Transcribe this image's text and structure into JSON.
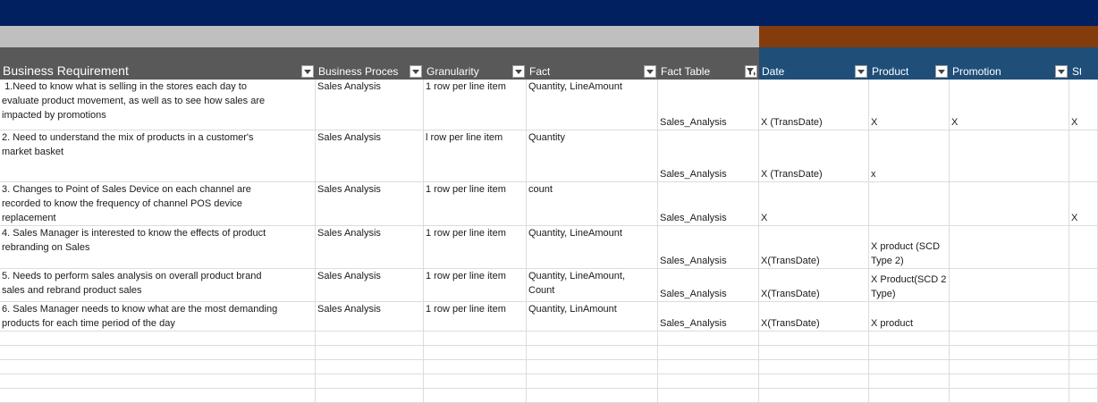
{
  "headers": {
    "business_requirement": "Business Requirement",
    "business_process": "Business Proces",
    "granularity": "Granularity",
    "fact": "Fact",
    "fact_table": "Fact Table",
    "date": "Date",
    "product": "Product",
    "promotion": "Promotion",
    "store": "Store"
  },
  "colors": {
    "title_band": "#002060",
    "grey_band": "#bfbfbf",
    "brown_band": "#843c0c",
    "header_dark": "#595959",
    "header_blue": "#1f4e79"
  },
  "filter_icons": {
    "business_requirement": "dropdown-arrow",
    "business_process": "dropdown-arrow",
    "granularity": "dropdown-arrow",
    "fact": "dropdown-arrow",
    "fact_table": "filter-funnel",
    "date": "dropdown-arrow",
    "product": "dropdown-arrow",
    "promotion": "dropdown-arrow"
  },
  "rows": [
    {
      "requirement": " 1.Need to know what is selling in the stores each day to\nevaluate product movement, as well as to see how sales are\nimpacted by promotions",
      "process": "Sales Analysis",
      "granularity": "1 row per line item",
      "fact": "Quantity, LineAmount",
      "fact_table": "Sales_Analysis",
      "date": "X (TransDate)",
      "product": "X",
      "promotion": "X",
      "store": "X"
    },
    {
      "requirement": "2. Need to understand the mix of products in a customer's\nmarket basket",
      "process": "Sales Analysis",
      "granularity": "l row per line item",
      "fact": "Quantity",
      "fact_table": "Sales_Analysis",
      "date": "X (TransDate)",
      "product": "x",
      "promotion": "",
      "store": ""
    },
    {
      "requirement": "3. Changes to Point of Sales Device on each channel are\nrecorded to know the frequency of channel POS device\nreplacement",
      "process": "Sales Analysis",
      "granularity": "1 row per line item",
      "fact": "count",
      "fact_table": "Sales_Analysis",
      "date": "X",
      "product": "",
      "promotion": "",
      "store": "X"
    },
    {
      "requirement": "4. Sales Manager is interested to know the effects of product\nrebranding on Sales",
      "process": "Sales Analysis",
      "granularity": "1 row per line item",
      "fact": "Quantity, LineAmount",
      "fact_table": "Sales_Analysis",
      "date": "X(TransDate)",
      "product": "X product (SCD\nType 2)",
      "promotion": "",
      "store": ""
    },
    {
      "requirement": "5. Needs to perform sales analysis on overall product brand\nsales and rebrand product sales",
      "process": "Sales Analysis",
      "granularity": "1 row per line item",
      "fact": "Quantity, LineAmount,\nCount",
      "fact_table": "Sales_Analysis",
      "date": "X(TransDate)",
      "product": "X Product(SCD 2\nType)",
      "promotion": "",
      "store": ""
    },
    {
      "requirement": "6. Sales Manager needs to know what are the most demanding\nproducts for each time period of the day",
      "process": "Sales Analysis",
      "granularity": "1 row per line item",
      "fact": "Quantity, LinAmount",
      "fact_table": "Sales_Analysis",
      "date": "X(TransDate)",
      "product": "X product",
      "promotion": "",
      "store": ""
    }
  ]
}
